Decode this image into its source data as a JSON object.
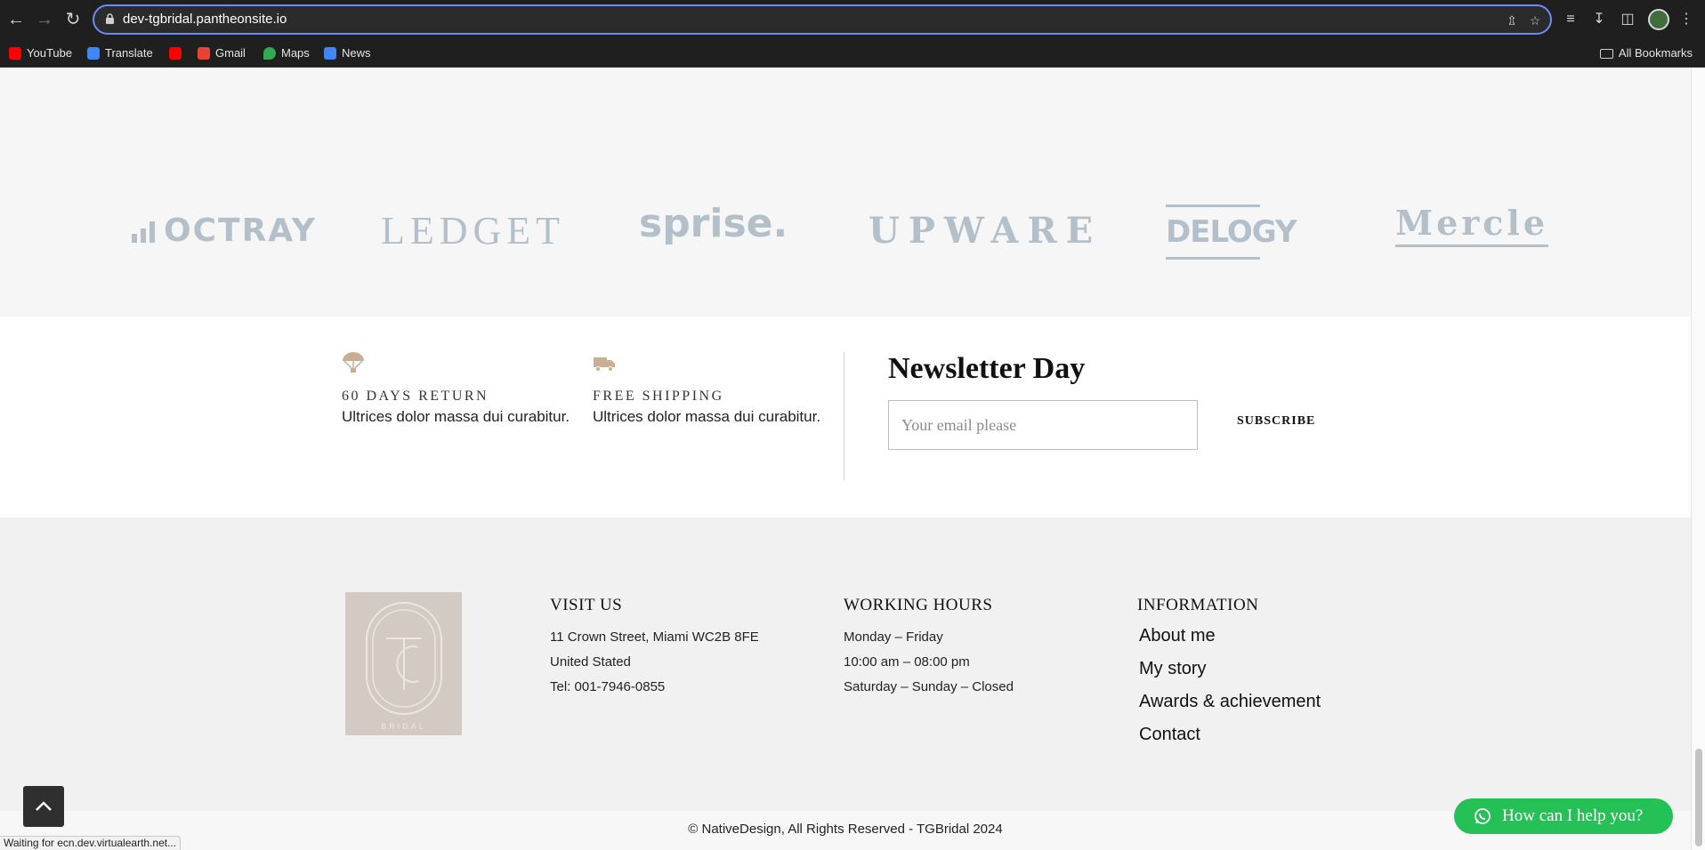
{
  "browser": {
    "url": "dev-tgbridal.pantheonsite.io",
    "bookmarks": [
      {
        "label": "YouTube",
        "icon": "youtube-icon",
        "color": "#ff0000"
      },
      {
        "label": "Translate",
        "icon": "translate-icon",
        "color": "#4285f4"
      },
      {
        "label": "",
        "icon": "youtube-icon",
        "color": "#ff0000"
      },
      {
        "label": "Gmail",
        "icon": "gmail-icon",
        "color": "#ea4335"
      },
      {
        "label": "Maps",
        "icon": "maps-icon",
        "color": "#34a853"
      },
      {
        "label": "News",
        "icon": "news-icon",
        "color": "#4285f4"
      }
    ],
    "all_bookmarks": "All Bookmarks"
  },
  "partner_logos": [
    "OCTRAY",
    "LEDGET",
    "sprise.",
    "UPWARE",
    "DELOGY",
    "Mercle"
  ],
  "features": [
    {
      "icon": "parachute-icon",
      "title": "60 DAYS RETURN",
      "text": "Ultrices dolor massa dui curabitur."
    },
    {
      "icon": "truck-icon",
      "title": "FREE SHIPPING",
      "text": "Ultrices dolor massa dui curabitur."
    }
  ],
  "newsletter": {
    "title": "Newsletter Day",
    "placeholder": "Your email please",
    "button": "SUBSCRIBE"
  },
  "footer": {
    "logo_text": "BRIDAL",
    "visit": {
      "title": "VISIT US",
      "lines": [
        "11 Crown Street, Miami WC2B 8FE",
        "United Stated",
        "Tel: 001-7946-0855"
      ]
    },
    "hours": {
      "title": "WORKING HOURS",
      "lines": [
        "Monday – Friday",
        "10:00 am – 08:00 pm",
        "Saturday – Sunday – Closed"
      ]
    },
    "info": {
      "title": "INFORMATION",
      "links": [
        "About me",
        "My story",
        "Awards & achievement",
        "Contact"
      ]
    },
    "copyright": "© NativeDesign, All Rights Reserved - TGBridal 2024"
  },
  "chat": {
    "label": "How can I help you?",
    "color": "#25c056"
  },
  "status_bar": "Waiting for ecn.dev.virtualearth.net..."
}
